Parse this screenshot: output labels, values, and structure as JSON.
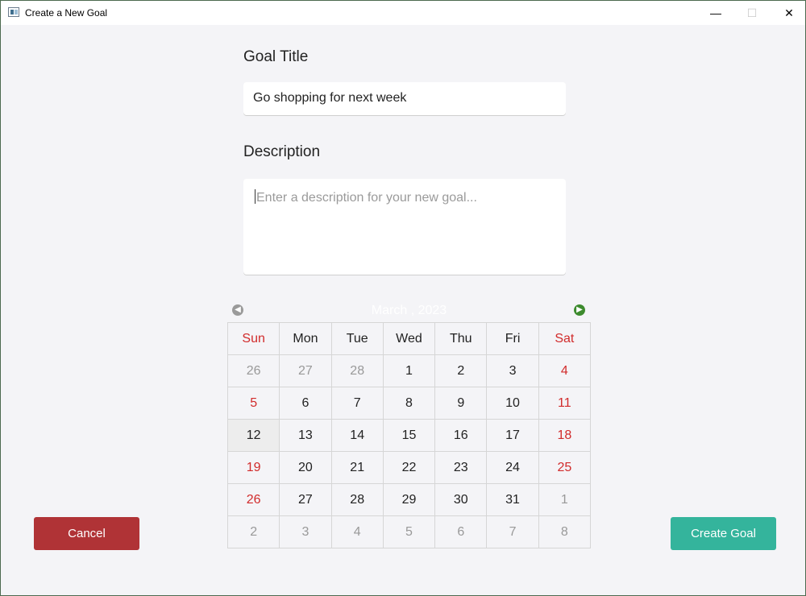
{
  "window": {
    "title": "Create a New Goal",
    "minimize_glyph": "—",
    "maximize_glyph": "☐",
    "close_glyph": "✕"
  },
  "form": {
    "goal_title_label": "Goal Title",
    "goal_title_value": "Go shopping for next week",
    "description_label": "Description",
    "description_placeholder": "Enter a description for your new goal..."
  },
  "calendar": {
    "month_label": "March , 2023",
    "prev_icon": "arrow-left-circle-icon",
    "next_icon": "arrow-right-circle-icon",
    "day_headers": [
      "Sun",
      "Mon",
      "Tue",
      "Wed",
      "Thu",
      "Fri",
      "Sat"
    ],
    "weeks": [
      [
        "26",
        "27",
        "28",
        "1",
        "2",
        "3",
        "4"
      ],
      [
        "5",
        "6",
        "7",
        "8",
        "9",
        "10",
        "11"
      ],
      [
        "12",
        "13",
        "14",
        "15",
        "16",
        "17",
        "18"
      ],
      [
        "19",
        "20",
        "21",
        "22",
        "23",
        "24",
        "25"
      ],
      [
        "26",
        "27",
        "28",
        "29",
        "30",
        "31",
        "1"
      ],
      [
        "2",
        "3",
        "4",
        "5",
        "6",
        "7",
        "8"
      ]
    ],
    "weekend_color": "#d12b2b"
  },
  "buttons": {
    "cancel_label": "Cancel",
    "create_label": "Create Goal",
    "cancel_color": "#b03336",
    "create_color": "#34b49c"
  }
}
